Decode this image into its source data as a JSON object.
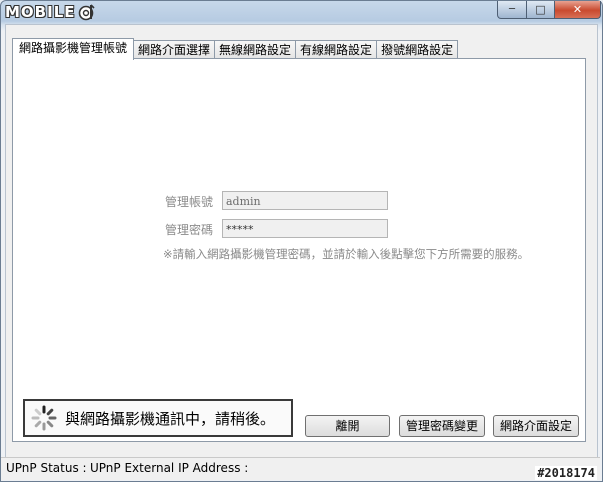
{
  "window": {
    "brand_text": "MOBILE",
    "brand_icon": "mobile01-logo-icon",
    "controls": {
      "minimize": "─",
      "maximize": "□",
      "close": "✕"
    }
  },
  "tabs": [
    {
      "label": "網路攝影機管理帳號",
      "active": true
    },
    {
      "label": "網路介面選擇",
      "active": false
    },
    {
      "label": "無線網路設定",
      "active": false
    },
    {
      "label": "有線網路設定",
      "active": false
    },
    {
      "label": "撥號網路設定",
      "active": false
    }
  ],
  "form": {
    "account_label": "管理帳號",
    "account_value": "admin",
    "password_label": "管理密碼",
    "password_value": "*****",
    "note": "※請輸入網路攝影機管理密碼，並請於輸入後點擊您下方所需要的服務。"
  },
  "status_message": "與網路攝影機通訊中，請稍後。",
  "buttons": {
    "leave": "離開",
    "change_password": "管理密碼變更",
    "interface_settings": "網路介面設定"
  },
  "statusbar": {
    "upnp_status": "UPnP Status :",
    "external_ip": "UPnP External IP Address :"
  },
  "watermark": "#2018174",
  "colors": {
    "close_button": "#c94a2f",
    "titlebar": "#b6cbe2"
  }
}
